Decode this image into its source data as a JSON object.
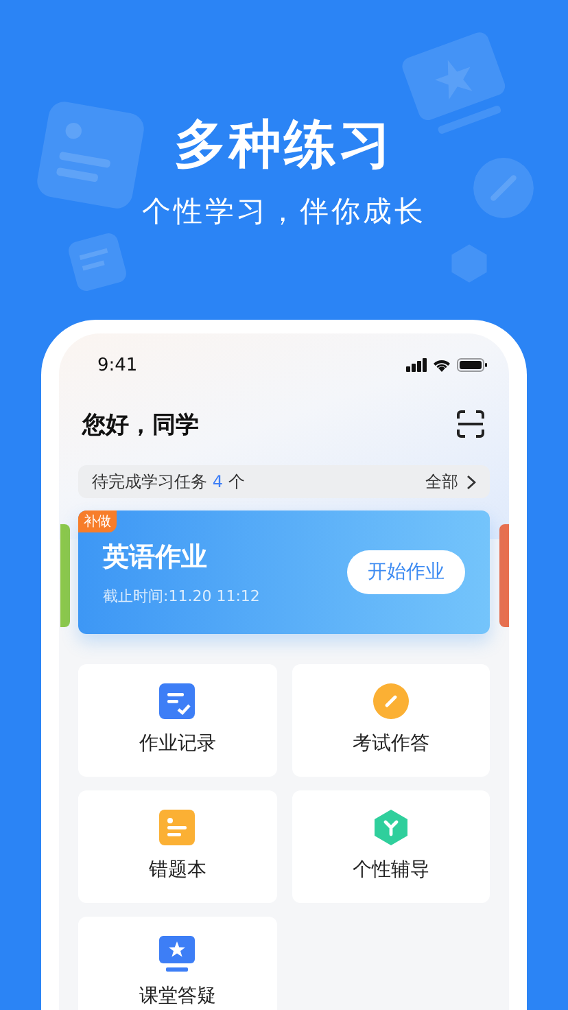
{
  "hero": {
    "title": "多种练习",
    "subtitle": "个性学习，伴你成长"
  },
  "status_bar": {
    "time": "9:41"
  },
  "header": {
    "greeting": "您好，同学"
  },
  "tasks": {
    "label": "待完成学习任务",
    "count": "4",
    "unit": "个",
    "all_link": "全部"
  },
  "homework_card": {
    "badge": "补做",
    "title": "英语作业",
    "deadline": "截止时间:11.20 11:12",
    "button": "开始作业"
  },
  "peek_cards": [
    {
      "color": "#8cc84b"
    },
    {
      "color": "#e8704f"
    }
  ],
  "tiles": [
    {
      "kind": "record",
      "label": "作业记录"
    },
    {
      "kind": "exam",
      "label": "考试作答"
    },
    {
      "kind": "mistakes",
      "label": "错题本"
    },
    {
      "kind": "tutoring",
      "label": "个性辅导"
    },
    {
      "kind": "qa",
      "label": "课堂答疑"
    }
  ]
}
